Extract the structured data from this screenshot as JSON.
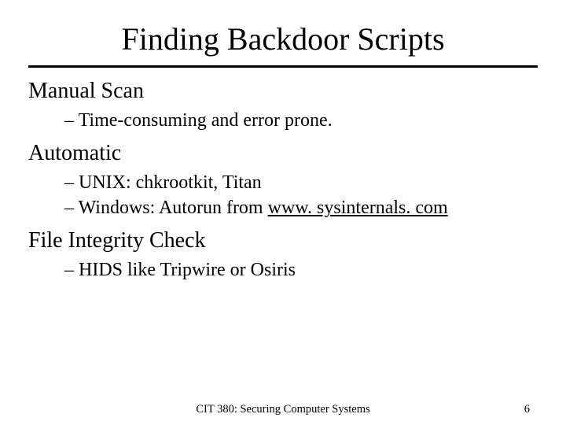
{
  "title": "Finding Backdoor Scripts",
  "sections": [
    {
      "heading": "Manual Scan",
      "items": [
        {
          "prefix": "– ",
          "text": "Time-consuming and error prone."
        }
      ]
    },
    {
      "heading": "Automatic",
      "items": [
        {
          "prefix": "– ",
          "text": "UNIX: chkrootkit, Titan"
        },
        {
          "prefix": "– ",
          "text_pre": "Windows: Autorun from ",
          "link": "www. sysinternals. com"
        }
      ]
    },
    {
      "heading": "File Integrity Check",
      "items": [
        {
          "prefix": "– ",
          "text": "HIDS like Tripwire or Osiris"
        }
      ]
    }
  ],
  "footer": {
    "course": "CIT 380: Securing Computer Systems",
    "page": "6"
  }
}
